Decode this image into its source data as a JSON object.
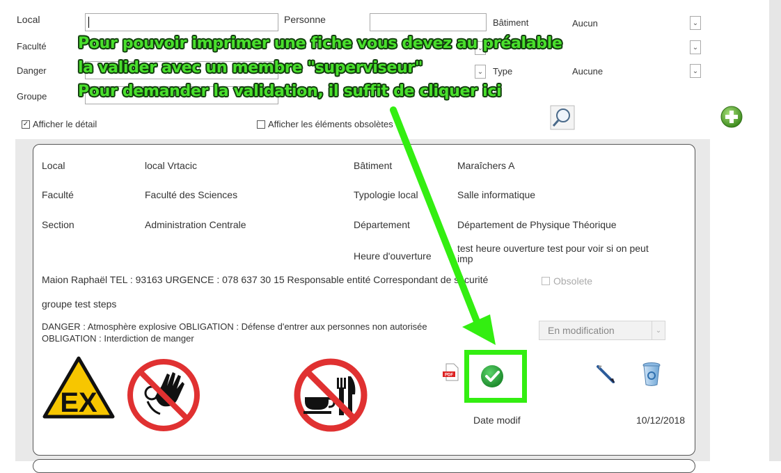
{
  "filters": {
    "local_label": "Local",
    "personne_label": "Personne",
    "batiment_label": "Bâtiment",
    "batiment_value": "Aucun",
    "faculte_label": "Faculté",
    "danger_label": "Danger",
    "type_label": "Type",
    "type_value": "Aucune",
    "groupe_label": "Groupe",
    "afficher_detail_label": "Afficher le détail",
    "afficher_obsoletes_label": "Afficher les éléments obsolètes"
  },
  "annotation": {
    "line1": "Pour pouvoir imprimer une fiche vous devez au préalable",
    "line2": "la valider avec un membre \"superviseur\"",
    "line3": "Pour demander la validation, il suffit de cliquer ici"
  },
  "record": {
    "local_label": "Local",
    "local_value": "local Vrtacic",
    "batiment_label": "Bâtiment",
    "batiment_value": "Maraîchers A",
    "faculte_label": "Faculté",
    "faculte_value": "Faculté des Sciences",
    "typologie_label": "Typologie local",
    "typologie_value": "Salle informatique",
    "section_label": "Section",
    "section_value": "Administration Centrale",
    "departement_label": "Département",
    "departement_value": "Département de Physique Théorique",
    "heure_label": "Heure d'ouverture",
    "heure_value": "test heure ouverture test pour voir si on peut imp",
    "contact": "Maion Raphaël TEL : 93163 URGENCE : 078 637 30 15 Responsable entité Correspondant de sécurité",
    "obsolete_label": "Obsolete",
    "groupe": "groupe test steps",
    "dangers_line1": "DANGER : Atmosphère explosive OBLIGATION : Défense d'entrer aux personnes non autorisée",
    "dangers_line2": "OBLIGATION : Interdiction de manger",
    "status_value": "En modification",
    "ex_sign_text": "EX",
    "pdf_icon_text": "PDF",
    "date_label": "Date modif",
    "date_value": "10/12/2018"
  },
  "colors": {
    "annotation_green": "#49e02c",
    "arrow_green": "#33ee11",
    "validate_green": "#27a23a",
    "prohibition_red": "#e03131",
    "warning_yellow": "#f7c600"
  }
}
